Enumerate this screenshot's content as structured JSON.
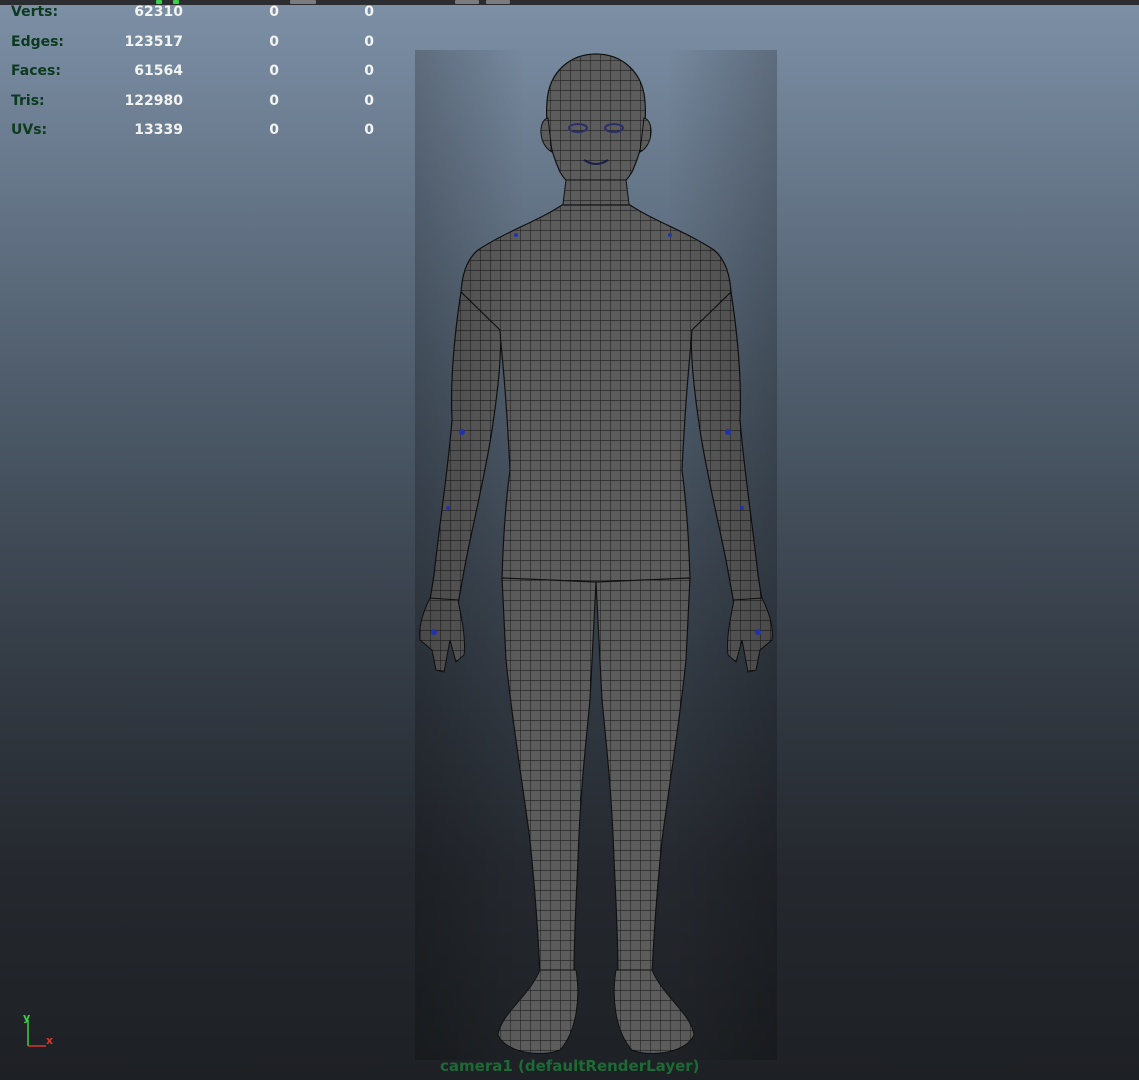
{
  "hud": {
    "rows": [
      {
        "label": "Verts:",
        "v1": "62310",
        "v2": "0",
        "v3": "0"
      },
      {
        "label": "Edges:",
        "v1": "123517",
        "v2": "0",
        "v3": "0"
      },
      {
        "label": "Faces:",
        "v1": "61564",
        "v2": "0",
        "v3": "0"
      },
      {
        "label": "Tris:",
        "v1": "122980",
        "v2": "0",
        "v3": "0"
      },
      {
        "label": "UVs:",
        "v1": "13339",
        "v2": "0",
        "v3": "0"
      }
    ]
  },
  "axis": {
    "y_label": "y",
    "x_label": "x",
    "y_color": "#3ccf4a",
    "x_color": "#d23a2a"
  },
  "camera": {
    "label": "camera1 (defaultRenderLayer)"
  },
  "colors": {
    "hud_label": "#0c3a1e",
    "hud_value": "#f2f4f2",
    "mesh_fill": "#5c5c5c",
    "mesh_wire": "#111111",
    "camera_label": "#1e6a35"
  },
  "icons": {
    "model": "human-base-mesh-wireframe",
    "axis": "xyz-view-axis-icon"
  }
}
